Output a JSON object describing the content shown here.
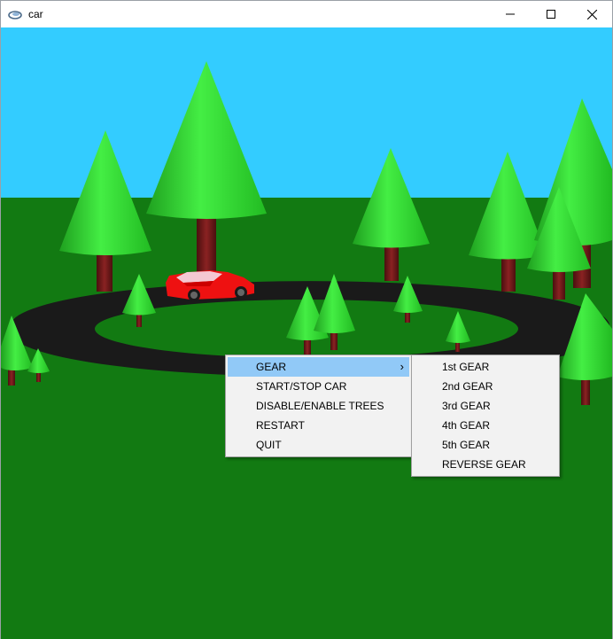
{
  "window": {
    "title": "car",
    "buttons": {
      "minimize_icon": "minimize-icon",
      "maximize_icon": "maximize-icon",
      "close_icon": "close-icon"
    }
  },
  "scene": {
    "sky_color": "#33ccff",
    "ground_color": "#127a12",
    "track_color": "#1a1a1a",
    "car_color": "#ee1111",
    "tree_foliage_color": "#33dd33",
    "tree_trunk_color": "#7a1a1a"
  },
  "context_menu": {
    "items": [
      {
        "label": "GEAR",
        "has_submenu": true,
        "highlighted": true
      },
      {
        "label": "START/STOP CAR"
      },
      {
        "label": "DISABLE/ENABLE TREES"
      },
      {
        "label": "RESTART"
      },
      {
        "label": "QUIT"
      }
    ],
    "highlight_color": "#91c9f7"
  },
  "gear_submenu": {
    "items": [
      {
        "label": "1st GEAR"
      },
      {
        "label": "2nd GEAR"
      },
      {
        "label": "3rd GEAR"
      },
      {
        "label": "4th GEAR"
      },
      {
        "label": "5th GEAR"
      },
      {
        "label": "REVERSE GEAR"
      }
    ]
  }
}
